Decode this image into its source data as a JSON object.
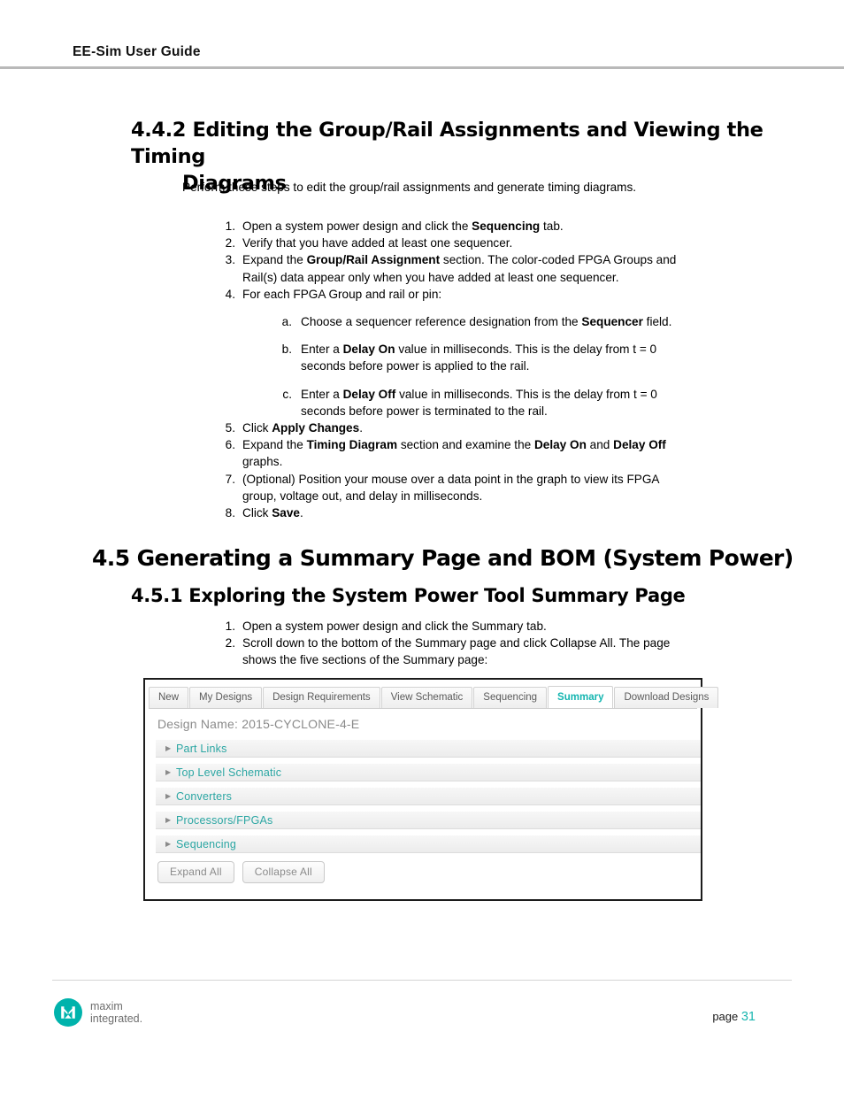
{
  "header": {
    "running_title": "EE-Sim User Guide"
  },
  "sections": {
    "s442": {
      "number": "4.4.2",
      "title_line1": "Editing the Group/Rail Assignments and Viewing the Timing",
      "title_line2": "Diagrams",
      "intro": "Perform these steps to edit the group/rail assignments and generate timing diagrams.",
      "steps": [
        {
          "num": "1.",
          "parts": [
            {
              "t": "Open a system power design and click the ",
              "b": false
            },
            {
              "t": "Sequencing",
              "b": true
            },
            {
              "t": " tab.",
              "b": false
            }
          ]
        },
        {
          "num": "2.",
          "parts": [
            {
              "t": "Verify that you have added at least one sequencer.",
              "b": false
            }
          ]
        },
        {
          "num": "3.",
          "parts": [
            {
              "t": "Expand the ",
              "b": false
            },
            {
              "t": "Group/Rail Assignment",
              "b": true
            },
            {
              "t": " section. The color-coded FPGA Groups and Rail(s) data appear only when you have added at least one sequencer.",
              "b": false
            }
          ]
        },
        {
          "num": "4.",
          "parts": [
            {
              "t": "For each FPGA Group and rail or pin:",
              "b": false
            }
          ],
          "substeps": [
            {
              "num": "a.",
              "parts": [
                {
                  "t": "Choose a sequencer reference designation from the ",
                  "b": false
                },
                {
                  "t": "Sequencer",
                  "b": true
                },
                {
                  "t": " field.",
                  "b": false
                }
              ]
            },
            {
              "num": "b.",
              "parts": [
                {
                  "t": "Enter a ",
                  "b": false
                },
                {
                  "t": "Delay On",
                  "b": true
                },
                {
                  "t": " value in milliseconds. This is the delay from t = 0 seconds before power is applied to the rail.",
                  "b": false
                }
              ]
            },
            {
              "num": "c.",
              "parts": [
                {
                  "t": "Enter a ",
                  "b": false
                },
                {
                  "t": "Delay Off",
                  "b": true
                },
                {
                  "t": " value in milliseconds. This is the delay from t = 0 seconds before power is terminated to the rail.",
                  "b": false
                }
              ]
            }
          ]
        },
        {
          "num": "5.",
          "parts": [
            {
              "t": "Click ",
              "b": false
            },
            {
              "t": "Apply Changes",
              "b": true
            },
            {
              "t": ".",
              "b": false
            }
          ]
        },
        {
          "num": "6.",
          "parts": [
            {
              "t": "Expand the ",
              "b": false
            },
            {
              "t": "Timing Diagram",
              "b": true
            },
            {
              "t": " section and examine the ",
              "b": false
            },
            {
              "t": "Delay On",
              "b": true
            },
            {
              "t": " and ",
              "b": false
            },
            {
              "t": "Delay Off",
              "b": true
            },
            {
              "t": " graphs.",
              "b": false
            }
          ]
        },
        {
          "num": "7.",
          "parts": [
            {
              "t": "(Optional) Position your mouse over a data point in the graph to view its FPGA group, voltage out, and delay in milliseconds.",
              "b": false
            }
          ]
        },
        {
          "num": "8.",
          "parts": [
            {
              "t": "Click ",
              "b": false
            },
            {
              "t": "Save",
              "b": true
            },
            {
              "t": ".",
              "b": false
            }
          ]
        }
      ]
    },
    "s45": {
      "title": "4.5 Generating a Summary Page and BOM (System Power)"
    },
    "s451": {
      "title": "4.5.1 Exploring the System Power Tool Summary Page",
      "steps": [
        {
          "num": "1.",
          "parts": [
            {
              "t": "Open a system power design and click the Summary tab.",
              "b": false
            }
          ]
        },
        {
          "num": "2.",
          "parts": [
            {
              "t": "Scroll down to the bottom of the Summary page and click Collapse All. The page shows the five sections of the Summary page:",
              "b": false
            }
          ]
        }
      ]
    }
  },
  "screenshot": {
    "tabs": [
      {
        "label": "New",
        "active": false
      },
      {
        "label": "My Designs",
        "active": false
      },
      {
        "label": "Design Requirements",
        "active": false
      },
      {
        "label": "View Schematic",
        "active": false
      },
      {
        "label": "Sequencing",
        "active": false
      },
      {
        "label": "Summary",
        "active": true
      },
      {
        "label": "Download Designs",
        "active": false
      }
    ],
    "design_name_label": "Design Name: 2015-CYCLONE-4-E",
    "caret_glyph": "▶",
    "sections": [
      {
        "label": "Part Links"
      },
      {
        "label": "Top Level Schematic"
      },
      {
        "label": "Converters"
      },
      {
        "label": "Processors/FPGAs"
      },
      {
        "label": "Sequencing"
      }
    ],
    "buttons": [
      {
        "label": "Expand All"
      },
      {
        "label": "Collapse All"
      }
    ],
    "accent_color": "#14b5b0",
    "link_color": "#2ba6a3"
  },
  "footer": {
    "logo_line1": "maxim",
    "logo_line2": "integrated.",
    "page_label": "page",
    "page_number": "31",
    "accent_color": "#19b6b0"
  }
}
